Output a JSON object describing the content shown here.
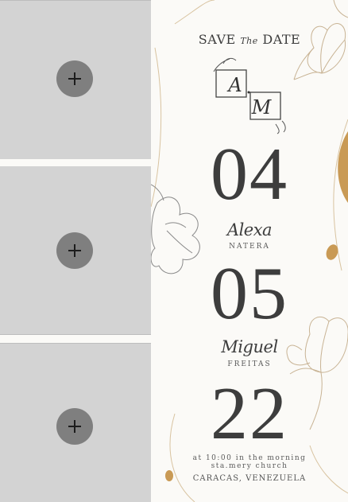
{
  "photo_slots": [
    {
      "add_label": "+"
    },
    {
      "add_label": "+"
    },
    {
      "add_label": "+"
    }
  ],
  "card": {
    "heading_save": "SAVE",
    "heading_the": "The",
    "heading_date": "DATE",
    "monogram_left": "A",
    "monogram_right": "M",
    "day": "04",
    "bride_first": "Alexa",
    "bride_last": "NATERA",
    "month": "05",
    "groom_first": "Miguel",
    "groom_last": "FREITAS",
    "year": "22",
    "time_line": "at 10:00 in the morning",
    "venue_line": "sta.mery church",
    "place_line": "CARACAS, VENEZUELA"
  },
  "colors": {
    "placeholder_bg": "#d3d3d3",
    "add_button": "#7f7f7f",
    "text": "#3d3d3d",
    "gold": "#c99a55"
  }
}
